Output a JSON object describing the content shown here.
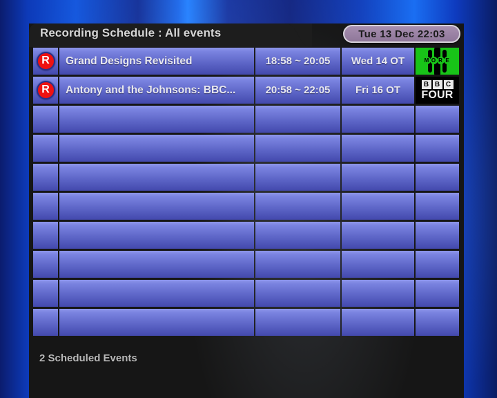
{
  "window": {
    "title": "Recording Schedule : All events",
    "clock": "Tue 13 Dec 22:03",
    "status": "2 Scheduled Events"
  },
  "colors": {
    "accent_blue": "#1a7bff",
    "panel_dark": "#161616",
    "row_blue_light": "#8e96ea",
    "row_blue_dark": "#4349ad",
    "record_red": "#ee1111",
    "clock_pill": "#9c84a6",
    "more4_green": "#18c318"
  },
  "grid": {
    "columns": [
      "flag",
      "title",
      "time",
      "date",
      "channel"
    ],
    "total_rows": 10,
    "rows": [
      {
        "flag": "R",
        "flag_icon": "record-icon",
        "title": "Grand Designs Revisited",
        "time": "18:58 ~ 20:05",
        "date": "Wed 14 OT",
        "channel_logo": "more4-logo",
        "channel_name": "More4",
        "more4_word": "MORE"
      },
      {
        "flag": "R",
        "flag_icon": "record-icon",
        "title": "Antony and the Johnsons: BBC...",
        "time": "20:58 ~ 22:05",
        "date": "Fri 16 OT",
        "channel_logo": "bbcfour-logo",
        "channel_name": "BBC FOUR",
        "bbc_letters": [
          "B",
          "B",
          "C"
        ],
        "bbc_word": "FOUR"
      },
      {
        "flag": "",
        "title": "",
        "time": "",
        "date": "",
        "channel_logo": ""
      },
      {
        "flag": "",
        "title": "",
        "time": "",
        "date": "",
        "channel_logo": ""
      },
      {
        "flag": "",
        "title": "",
        "time": "",
        "date": "",
        "channel_logo": ""
      },
      {
        "flag": "",
        "title": "",
        "time": "",
        "date": "",
        "channel_logo": ""
      },
      {
        "flag": "",
        "title": "",
        "time": "",
        "date": "",
        "channel_logo": ""
      },
      {
        "flag": "",
        "title": "",
        "time": "",
        "date": "",
        "channel_logo": ""
      },
      {
        "flag": "",
        "title": "",
        "time": "",
        "date": "",
        "channel_logo": ""
      },
      {
        "flag": "",
        "title": "",
        "time": "",
        "date": "",
        "channel_logo": ""
      }
    ]
  }
}
